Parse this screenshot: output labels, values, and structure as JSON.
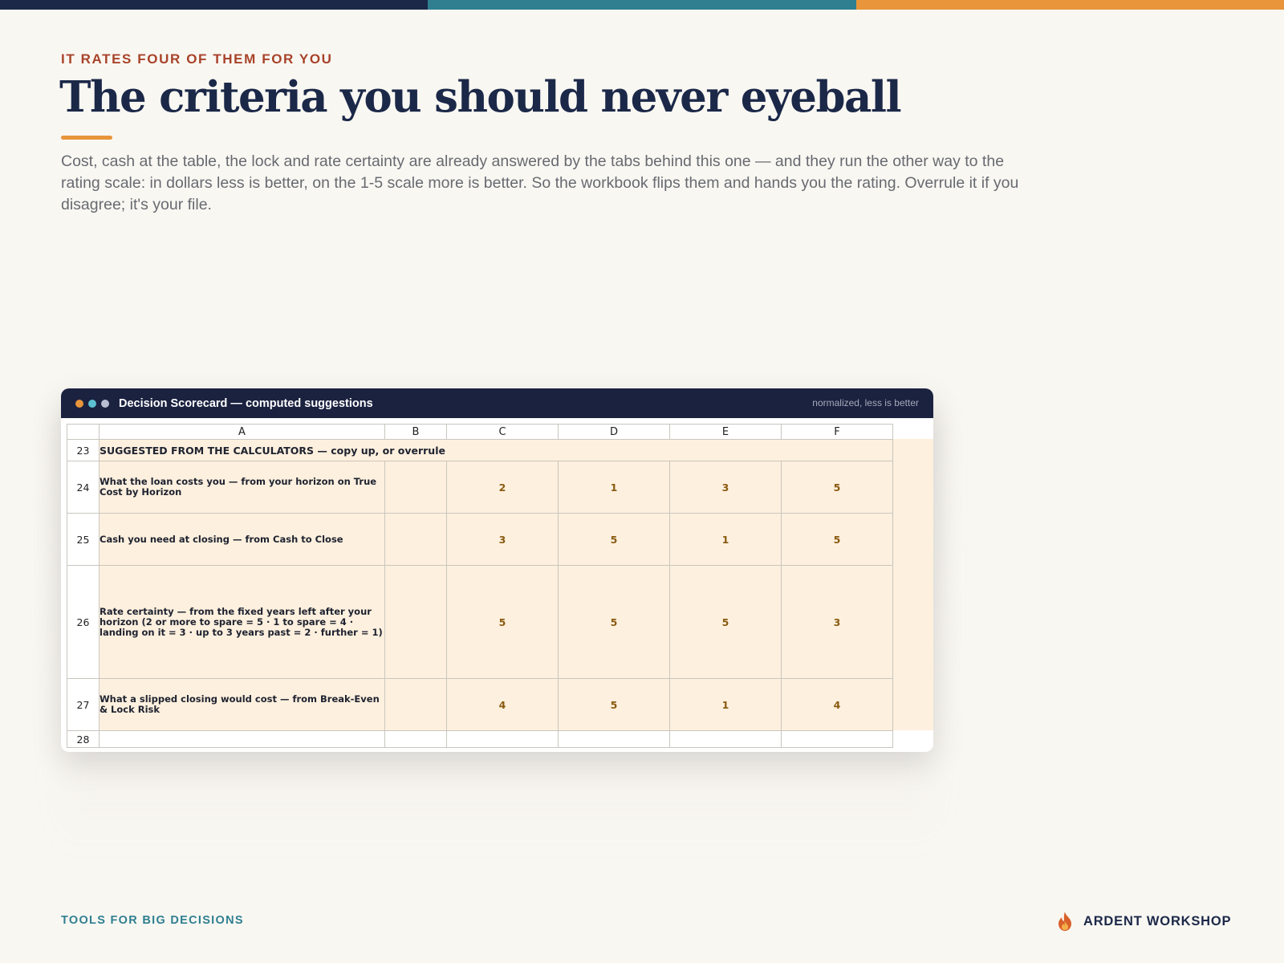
{
  "colors": {
    "navy": "#1b2848",
    "teal": "#2f7f91",
    "orange": "#e8953b",
    "rust": "#a8432a",
    "cell_fill": "#fdf0de"
  },
  "header": {
    "eyebrow": "IT RATES FOUR OF THEM FOR YOU",
    "title": "The criteria you should never eyeball",
    "intro": "Cost, cash at the table, the lock and rate certainty are already answered by the tabs behind this one — and they run the other way to the rating scale: in dollars less is better, on the 1-5 scale more is better. So the workbook flips them and hands you the rating. Overrule it if you disagree; it's your file."
  },
  "window": {
    "title": "Decision Scorecard — computed suggestions",
    "note": "normalized, less is better",
    "dot_colors": [
      "#e8953b",
      "#5cc1d3",
      "#b8bfd0"
    ]
  },
  "sheet": {
    "columns": [
      "A",
      "B",
      "C",
      "D",
      "E",
      "F"
    ],
    "section_row": {
      "num": "23",
      "label": "SUGGESTED FROM THE CALCULATORS — copy up, or overrule"
    },
    "rows": [
      {
        "num": "24",
        "label": "What the loan costs you — from your horizon on True Cost by Horizon",
        "values": [
          "2",
          "1",
          "3",
          "5"
        ]
      },
      {
        "num": "25",
        "label": "Cash you need at closing — from Cash to Close",
        "values": [
          "3",
          "5",
          "1",
          "5"
        ]
      },
      {
        "num": "26",
        "label": "Rate certainty — from the fixed years left after your horizon (2 or more to spare = 5 · 1 to spare = 4 · landing on it = 3 · up to 3 years past = 2 · further = 1)",
        "values": [
          "5",
          "5",
          "5",
          "3"
        ]
      },
      {
        "num": "27",
        "label": "What a slipped closing would cost — from Break-Even & Lock Risk",
        "values": [
          "4",
          "5",
          "1",
          "4"
        ]
      }
    ],
    "last_row": {
      "num": "28"
    }
  },
  "footer": {
    "tagline": "TOOLS FOR BIG DECISIONS",
    "brand": "ARDENT WORKSHOP",
    "brand_icon": "flame-icon"
  }
}
